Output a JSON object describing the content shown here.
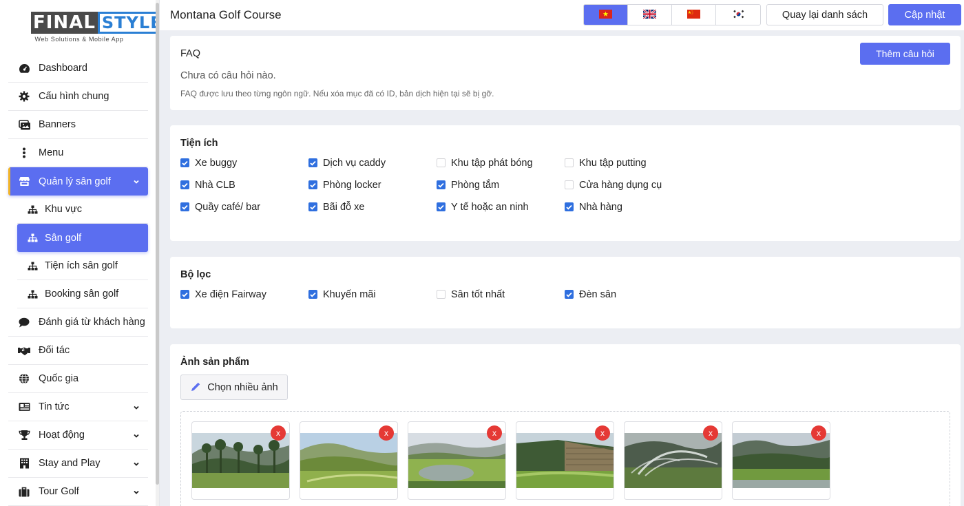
{
  "brand": {
    "logo_left": "FINAL",
    "logo_right": "STYLE",
    "tagline": "Web Solutions & Mobile App"
  },
  "sidebar": {
    "items": [
      {
        "label": "Dashboard",
        "icon": "dashboard-icon"
      },
      {
        "label": "Cấu hình chung",
        "icon": "gear-icon"
      },
      {
        "label": "Banners",
        "icon": "images-icon"
      },
      {
        "label": "Menu",
        "icon": "vertical-dots-icon"
      },
      {
        "label": "Quản lý sân golf",
        "icon": "store-icon",
        "active": true,
        "expanded": true
      },
      {
        "label": "Đánh giá từ khách hàng",
        "icon": "comment-icon"
      },
      {
        "label": "Đối tác",
        "icon": "handshake-icon"
      },
      {
        "label": "Quốc gia",
        "icon": "globe-icon"
      },
      {
        "label": "Tin tức",
        "icon": "newspaper-icon",
        "has_children": true
      },
      {
        "label": "Hoạt động",
        "icon": "trophy-icon",
        "has_children": true
      },
      {
        "label": "Stay and Play",
        "icon": "hotel-icon",
        "has_children": true
      },
      {
        "label": "Tour Golf",
        "icon": "briefcase-icon",
        "has_children": true
      }
    ],
    "sub_items": [
      {
        "label": "Khu vực",
        "icon": "sitemap-icon"
      },
      {
        "label": "Sân golf",
        "icon": "sitemap-icon",
        "active": true
      },
      {
        "label": "Tiện ích sân golf",
        "icon": "sitemap-icon"
      },
      {
        "label": "Booking sân golf",
        "icon": "sitemap-icon"
      }
    ]
  },
  "header": {
    "title": "Montana Golf Course",
    "languages": [
      {
        "code": "vi",
        "icon": "vietnam-flag-icon",
        "active": true
      },
      {
        "code": "en",
        "icon": "uk-flag-icon",
        "active": false
      },
      {
        "code": "zh",
        "icon": "china-flag-icon",
        "active": false
      },
      {
        "code": "ko",
        "icon": "korea-flag-icon",
        "active": false
      }
    ],
    "back_label": "Quay lại danh sách",
    "update_label": "Cập nhật"
  },
  "faq": {
    "title": "FAQ",
    "add_label": "Thêm câu hỏi",
    "empty_text": "Chưa có câu hỏi nào.",
    "note": "FAQ được lưu theo từng ngôn ngữ. Nếu xóa mục đã có ID, bản dịch hiện tại sẽ bị gỡ."
  },
  "amenities": {
    "title": "Tiện ích",
    "options": [
      {
        "label": "Xe buggy",
        "checked": true
      },
      {
        "label": "Dịch vụ caddy",
        "checked": true
      },
      {
        "label": "Khu tập phát bóng",
        "checked": false
      },
      {
        "label": "Khu tập putting",
        "checked": false
      },
      {
        "label": "Nhà CLB",
        "checked": true
      },
      {
        "label": "Phòng locker",
        "checked": true
      },
      {
        "label": "Phòng tắm",
        "checked": true
      },
      {
        "label": "Cửa hàng dụng cụ",
        "checked": false
      },
      {
        "label": "Quầy café/ bar",
        "checked": true
      },
      {
        "label": "Bãi đỗ xe",
        "checked": true
      },
      {
        "label": "Y tế hoặc an ninh",
        "checked": true
      },
      {
        "label": "Nhà hàng",
        "checked": true
      }
    ]
  },
  "filters": {
    "title": "Bộ lọc",
    "options": [
      {
        "label": "Xe điện Fairway",
        "checked": true
      },
      {
        "label": "Khuyến mãi",
        "checked": true
      },
      {
        "label": "Sân tốt nhất",
        "checked": false
      },
      {
        "label": "Đèn sân",
        "checked": true
      }
    ]
  },
  "images": {
    "title": "Ảnh sản phẩm",
    "pick_label": "Chọn nhiều ảnh",
    "remove_label": "x",
    "items": [
      {
        "scene": "forest-hills"
      },
      {
        "scene": "sunny-fairway"
      },
      {
        "scene": "pond-fairway"
      },
      {
        "scene": "terraced-hill"
      },
      {
        "scene": "sprinkler-mist"
      },
      {
        "scene": "misty-valley"
      }
    ]
  },
  "colors": {
    "accent": "#5b6ef0",
    "checkbox": "#2f6fdf",
    "remove": "#e53935",
    "active_marker": "#f0b429"
  }
}
